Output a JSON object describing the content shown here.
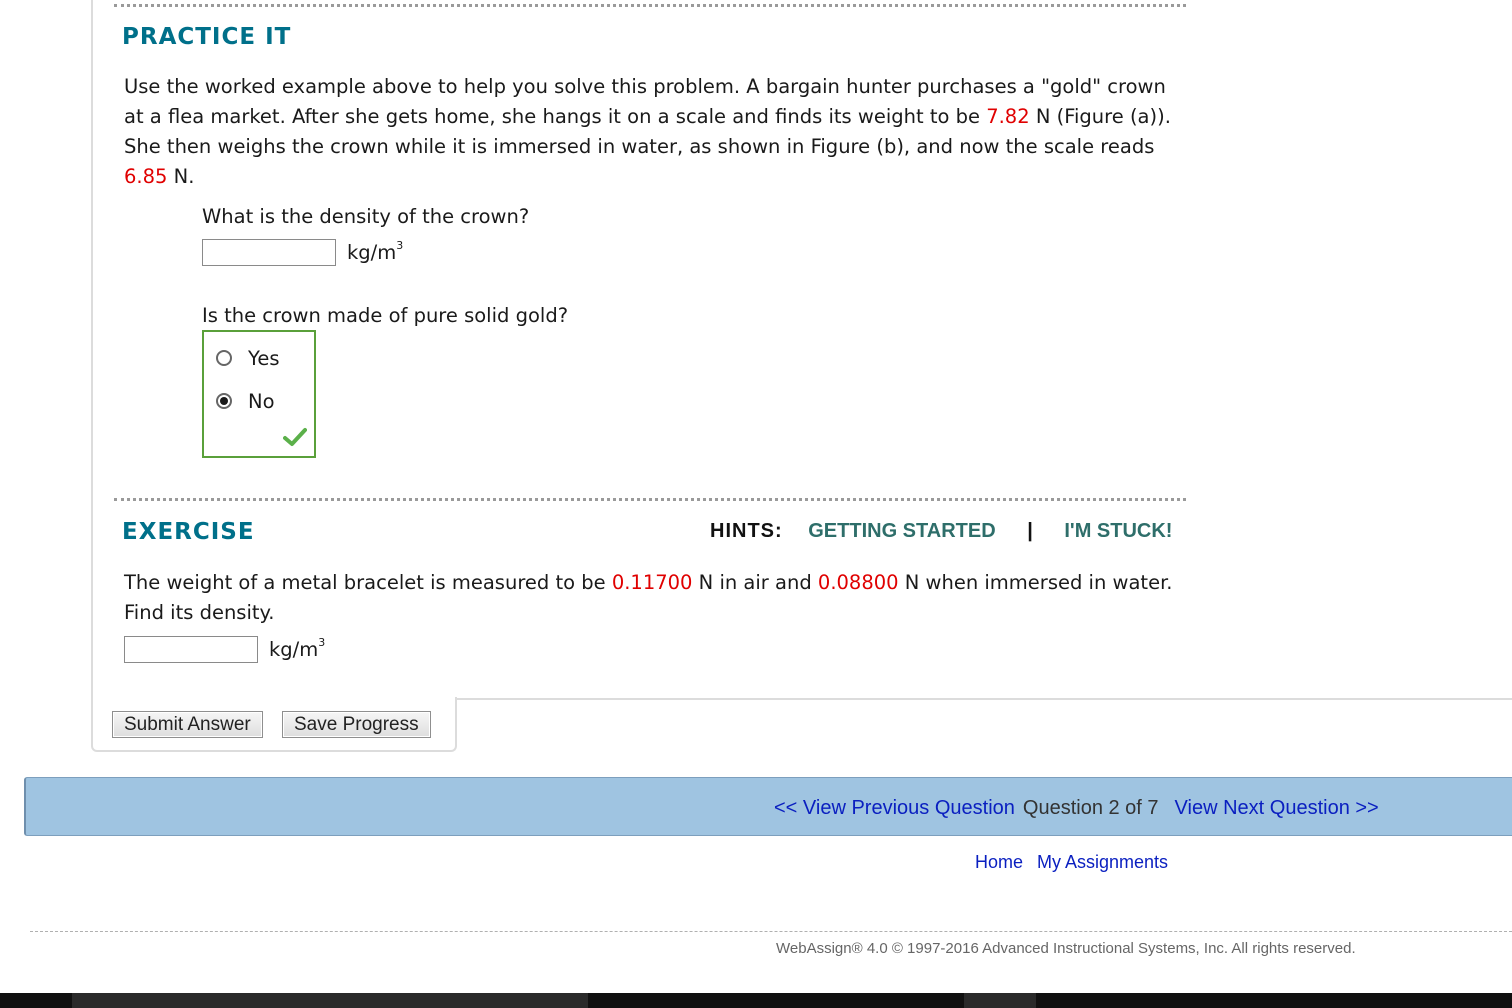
{
  "practice": {
    "heading": "PRACTICE IT",
    "intro_1": "Use the worked example above to help you solve this problem. A bargain hunter purchases a \"gold\" crown at a flea market. After she gets home, she hangs it on a scale and finds its weight to be ",
    "weight_air": "7.82",
    "intro_2": " N (Figure (a)). She then weighs the crown while it is immersed in water, as shown in Figure (b), and now the scale reads ",
    "weight_water": "6.85",
    "intro_3": " N.",
    "q1": "What is the density of the crown?",
    "q1_value": "",
    "unit": "kg/m",
    "unit_exp": "3",
    "q2": "Is the crown made of pure solid gold?",
    "options": [
      "Yes",
      "No"
    ],
    "selected": "No"
  },
  "exercise": {
    "heading": "EXERCISE",
    "hints_label": "HINTS:",
    "hint_1": "GETTING STARTED",
    "separator": "|",
    "hint_2": "I'M STUCK!",
    "text_1": "The weight of a metal bracelet is measured to be ",
    "weight_air": "0.11700",
    "text_2": " N in air and ",
    "weight_water": "0.08800",
    "text_3": " N when immersed in water. Find its density.",
    "value": "",
    "unit": "kg/m",
    "unit_exp": "3"
  },
  "buttons": {
    "submit": "Submit Answer",
    "save": "Save Progress"
  },
  "nav": {
    "prev": "<< View Previous Question",
    "position": "Question 2 of 7",
    "next": "View Next Question >>"
  },
  "footer": {
    "home": "Home",
    "assignments": "My Assignments",
    "copyright": "WebAssign® 4.0 © 1997-2016 Advanced Instructional Systems, Inc. All rights reserved."
  },
  "colors": {
    "heading": "#00708a",
    "highlight": "#e00000",
    "correct_border": "#5aa03a",
    "nav_bg": "#9fc4e1",
    "link": "#0a1fc0"
  }
}
